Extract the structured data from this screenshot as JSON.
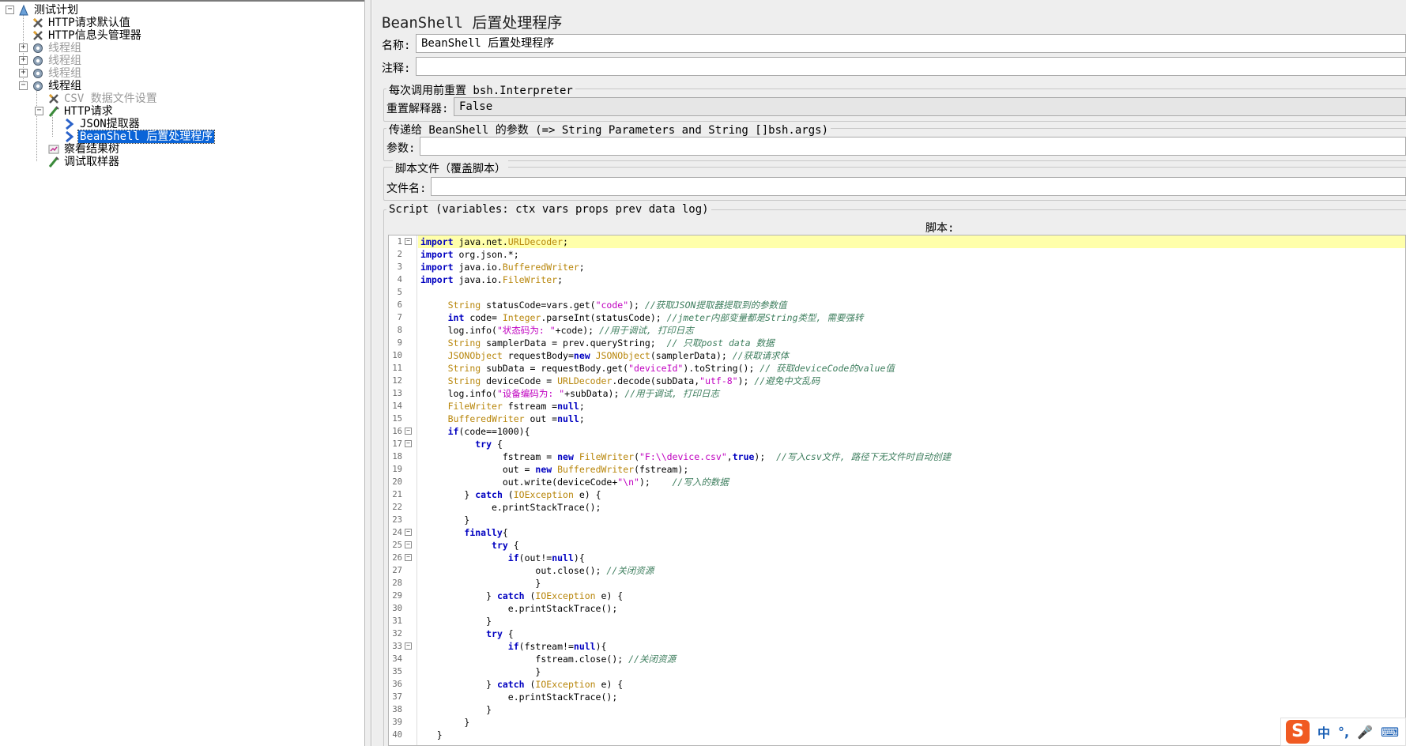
{
  "tree": {
    "items": [
      {
        "label": "测试计划",
        "icon": "test-plan-icon",
        "disabled": false,
        "selected": false
      },
      {
        "label": "HTTP请求默认值",
        "icon": "config-element-icon",
        "disabled": false,
        "selected": false
      },
      {
        "label": "HTTP信息头管理器",
        "icon": "config-element-icon",
        "disabled": false,
        "selected": false
      },
      {
        "label": "线程组",
        "icon": "thread-group-icon",
        "disabled": true,
        "selected": false
      },
      {
        "label": "线程组",
        "icon": "thread-group-icon",
        "disabled": true,
        "selected": false
      },
      {
        "label": "线程组",
        "icon": "thread-group-icon",
        "disabled": true,
        "selected": false
      },
      {
        "label": "线程组",
        "icon": "thread-group-icon",
        "disabled": false,
        "selected": false
      },
      {
        "label": "CSV 数据文件设置",
        "icon": "config-element-icon",
        "disabled": true,
        "selected": false
      },
      {
        "label": "HTTP请求",
        "icon": "sampler-icon",
        "disabled": false,
        "selected": false
      },
      {
        "label": "JSON提取器",
        "icon": "post-processor-icon",
        "disabled": false,
        "selected": false
      },
      {
        "label": "BeanShell 后置处理程序",
        "icon": "post-processor-icon",
        "disabled": false,
        "selected": true
      },
      {
        "label": "察看结果树",
        "icon": "listener-icon",
        "disabled": false,
        "selected": false
      },
      {
        "label": "调试取样器",
        "icon": "sampler-icon",
        "disabled": false,
        "selected": false
      }
    ]
  },
  "editor": {
    "title": "BeanShell 后置处理程序",
    "name_label": "名称:",
    "name_value": "BeanShell 后置处理程序",
    "comment_label": "注释:",
    "comment_value": "",
    "reset_group_title": "每次调用前重置 bsh.Interpreter",
    "reset_label": "重置解释器:",
    "reset_value": "False",
    "params_group_title": "传递给 BeanShell 的参数 (=> String Parameters and String []bsh.args)",
    "params_label": "参数:",
    "params_value": "",
    "file_group_title": "脚本文件（覆盖脚本）",
    "file_label": "文件名:",
    "file_value": "",
    "script_group_title": "Script (variables: ctx vars props prev data log)",
    "script_label": "脚本:"
  },
  "script_lines": [
    "import java.net.URLDecoder;",
    "import org.json.*;",
    "import java.io.BufferedWriter;",
    "import java.io.FileWriter;",
    "",
    "     String statusCode=vars.get(\"code\"); //获取JSON提取器提取到的参数值",
    "     int code= Integer.parseInt(statusCode); //jmeter内部变量都是String类型, 需要强转",
    "     log.info(\"状态码为: \"+code); //用于调试, 打印日志",
    "     String samplerData = prev.queryString;  // 只取post data 数据",
    "     JSONObject requestBody=new JSONObject(samplerData); //获取请求体",
    "     String subData = requestBody.get(\"deviceId\").toString(); // 获取deviceCode的value值",
    "     String deviceCode = URLDecoder.decode(subData,\"utf-8\"); //避免中文乱码",
    "     log.info(\"设备编码为: \"+subData); //用于调试, 打印日志",
    "     FileWriter fstream =null;",
    "     BufferedWriter out =null;",
    "     if(code==1000){",
    "          try {",
    "               fstream = new FileWriter(\"F:\\\\device.csv\",true);  //写入csv文件, 路径下无文件时自动创建",
    "               out = new BufferedWriter(fstream);",
    "               out.write(deviceCode+\"\\n\");    //写入的数据",
    "        } catch (IOException e) {",
    "             e.printStackTrace();",
    "        }",
    "        finally{",
    "             try {",
    "                if(out!=null){",
    "                     out.close(); //关闭资源",
    "                     }",
    "            } catch (IOException e) {",
    "                e.printStackTrace();",
    "            }",
    "            try {",
    "                if(fstream!=null){",
    "                     fstream.close(); //关闭资源",
    "                     }",
    "            } catch (IOException e) {",
    "                e.printStackTrace();",
    "            }",
    "        }",
    "   }"
  ],
  "fold_lines": [
    1,
    16,
    17,
    24,
    25,
    26,
    33
  ],
  "ime": {
    "logo": "S",
    "lang": "中",
    "punct": "°,",
    "mic": "🎤",
    "keyboard": "⌨"
  }
}
